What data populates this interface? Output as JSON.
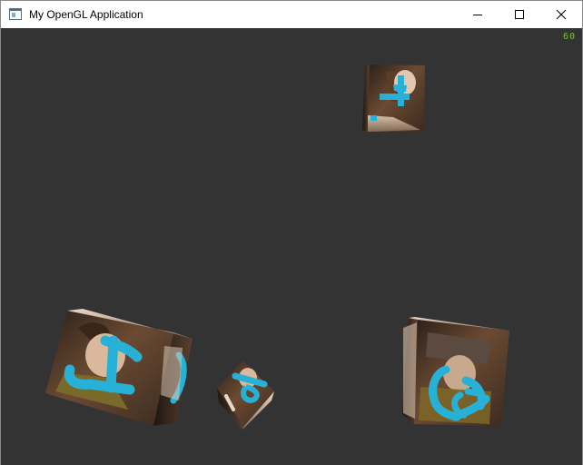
{
  "window": {
    "title": "My OpenGL Application",
    "app_icon": "window-app-icon",
    "controls": {
      "minimize_icon": "minimize-icon",
      "maximize_icon": "maximize-icon",
      "close_icon": "close-icon"
    }
  },
  "viewport": {
    "background": "#333333",
    "fps": "60",
    "fps_color": "#7ac231",
    "cube_count": 4,
    "accent": "#27b1d6"
  }
}
